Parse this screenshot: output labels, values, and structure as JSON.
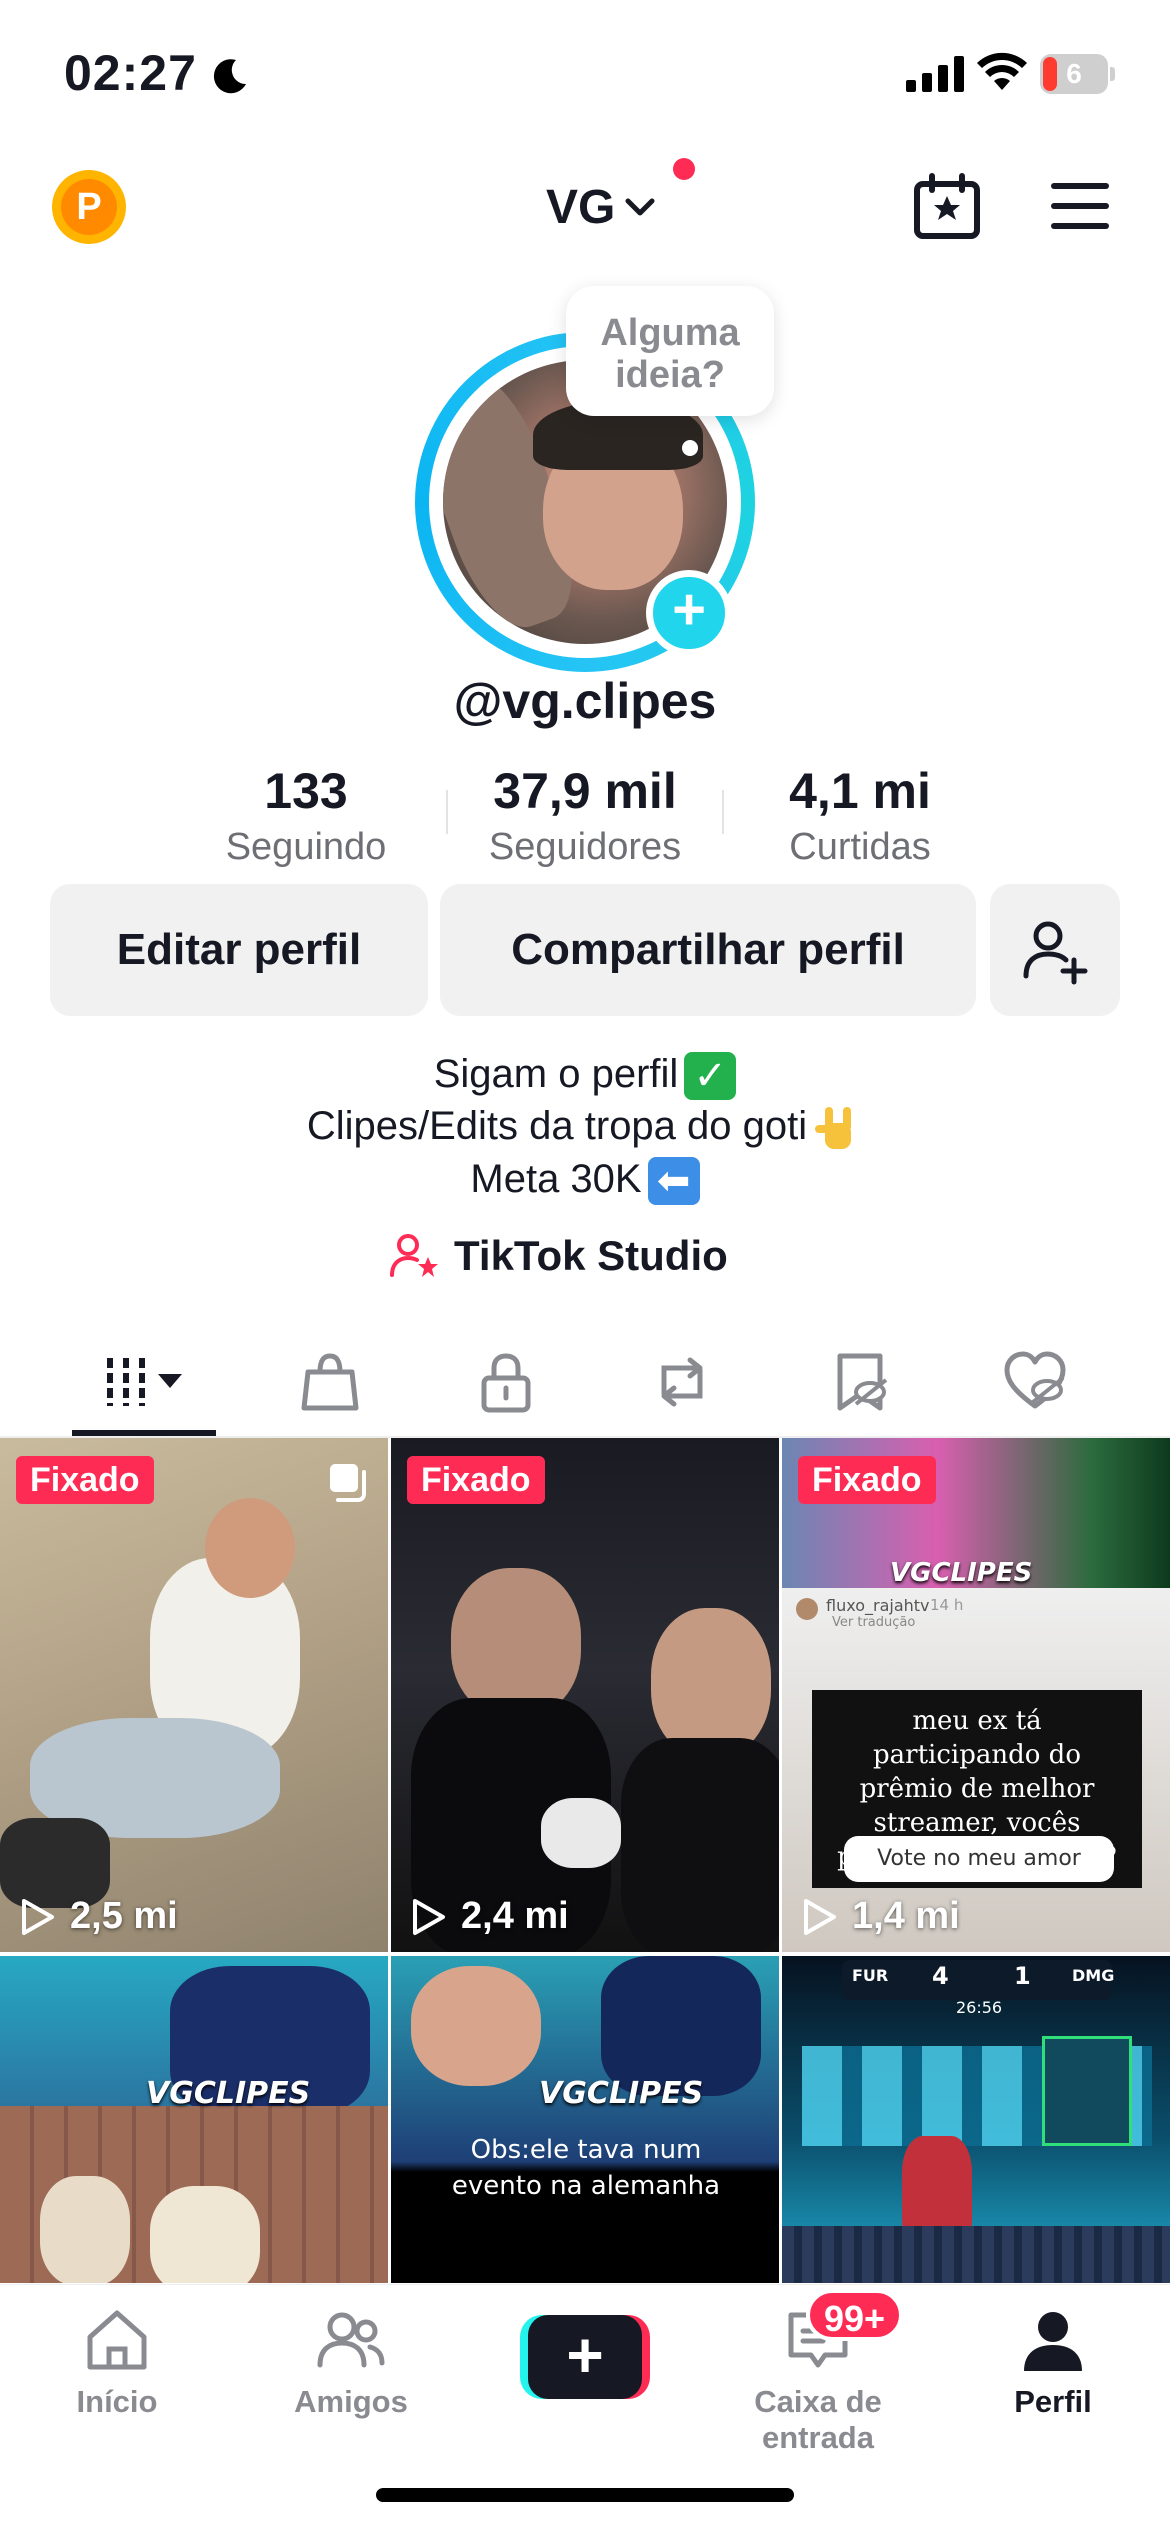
{
  "status_bar": {
    "time": "02:27",
    "battery": "6"
  },
  "header": {
    "account_name": "VG",
    "coin_letter": "P"
  },
  "profile": {
    "bubble_line1": "Alguma",
    "bubble_line2": "ideia?",
    "username": "@vg.clipes"
  },
  "stats": [
    {
      "value": "133",
      "label": "Seguindo"
    },
    {
      "value": "37,9 mil",
      "label": "Seguidores"
    },
    {
      "value": "4,1 mi",
      "label": "Curtidas"
    }
  ],
  "buttons": {
    "edit": "Editar perfil",
    "share": "Compartilhar perfil"
  },
  "bio": {
    "line1": "Sigam o perfil",
    "line2": "Clipes/Edits da tropa do goti",
    "line3": "Meta 30K"
  },
  "studio_label": "TikTok Studio",
  "videos": [
    {
      "pinned": "Fixado",
      "views": "2,5 mi"
    },
    {
      "pinned": "Fixado",
      "views": "2,4 mi"
    },
    {
      "pinned": "Fixado",
      "views": "1,4 mi"
    },
    {
      "watermark": "VGCLIPES"
    },
    {
      "watermark": "VGCLIPES",
      "caption": "Obs:ele tava num evento na alemanha"
    },
    {
      "score_left": "4",
      "score_right": "1",
      "team_left": "FUR",
      "team_right": "DMG",
      "clock": "26:56"
    }
  ],
  "video3_overlay": {
    "watermark": "VGCLIPES",
    "story_user": "fluxo_rajahtv",
    "story_time": "14 h",
    "story_translate": "Ver tradução",
    "story_text": "meu ex tá participando do prêmio de melhor streamer, vocês poderiam ajudar ele?",
    "story_link": "Vote no meu amor"
  },
  "nav": {
    "home": "Início",
    "friends": "Amigos",
    "inbox": "Caixa de entrada",
    "inbox_badge": "99+",
    "profile": "Perfil"
  }
}
